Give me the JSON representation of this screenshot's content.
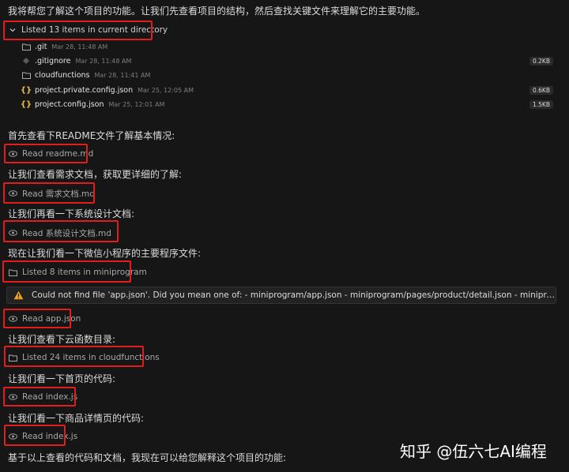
{
  "intro": "我将帮您了解这个项目的功能。让我们先查看项目的结构，然后查找关键文件来理解它的主要功能。",
  "directory": {
    "summary": "Listed 13 items in current directory",
    "files": [
      {
        "name": ".git",
        "date": "Mar 28, 11:48 AM",
        "size": "",
        "icon": "folder-icon"
      },
      {
        "name": ".gitignore",
        "date": "Mar 28, 11:48 AM",
        "size": "0.2KB",
        "icon": "git-file-icon"
      },
      {
        "name": "cloudfunctions",
        "date": "Mar 28, 11:41 AM",
        "size": "",
        "icon": "folder-icon"
      },
      {
        "name": "project.private.config.json",
        "date": "Mar 25, 12:05 AM",
        "size": "0.6KB",
        "icon": "json-icon"
      },
      {
        "name": "project.config.json",
        "date": "Mar 25, 12:01 AM",
        "size": "1.5KB",
        "icon": "json-icon"
      }
    ]
  },
  "steps": [
    {
      "text": "首先查看下README文件了解基本情况:",
      "tool": "Read readme.md",
      "icon": "eye-icon"
    },
    {
      "text": "让我们查看需求文档，获取更详细的了解:",
      "tool": "Read 需求文档.md",
      "icon": "eye-icon"
    },
    {
      "text": "让我们再看一下系统设计文档:",
      "tool": "Read 系统设计文档.md",
      "icon": "eye-icon"
    },
    {
      "text": "现在让我们看一下微信小程序的主要程序文件:",
      "tool": "Listed 8 items in miniprogram",
      "icon": "folder-icon"
    }
  ],
  "error": {
    "message": "Could not find file 'app.json'. Did you mean one of: - miniprogram/app.json - miniprogram/pages/product/detail.json - miniprogram/pages/product/..."
  },
  "steps2": [
    {
      "text": "",
      "tool": "Read app.json",
      "icon": "eye-icon"
    },
    {
      "text": "让我们查看下云函数目录:",
      "tool": "Listed 24 items in cloudfunctions",
      "icon": "folder-icon"
    },
    {
      "text": "让我们看一下首页的代码:",
      "tool": "Read index.js",
      "icon": "eye-icon"
    },
    {
      "text": "让我们看一下商品详情页的代码:",
      "tool": "Read index.js",
      "icon": "eye-icon"
    }
  ],
  "conclusion": "基于以上查看的代码和文档，我现在可以给您解释这个项目的功能:",
  "watermark": "知乎 @伍六七AI编程",
  "colors": {
    "highlight": "#e01e1e",
    "warning": "#f0a020",
    "json_brace": "#e6c04a"
  }
}
